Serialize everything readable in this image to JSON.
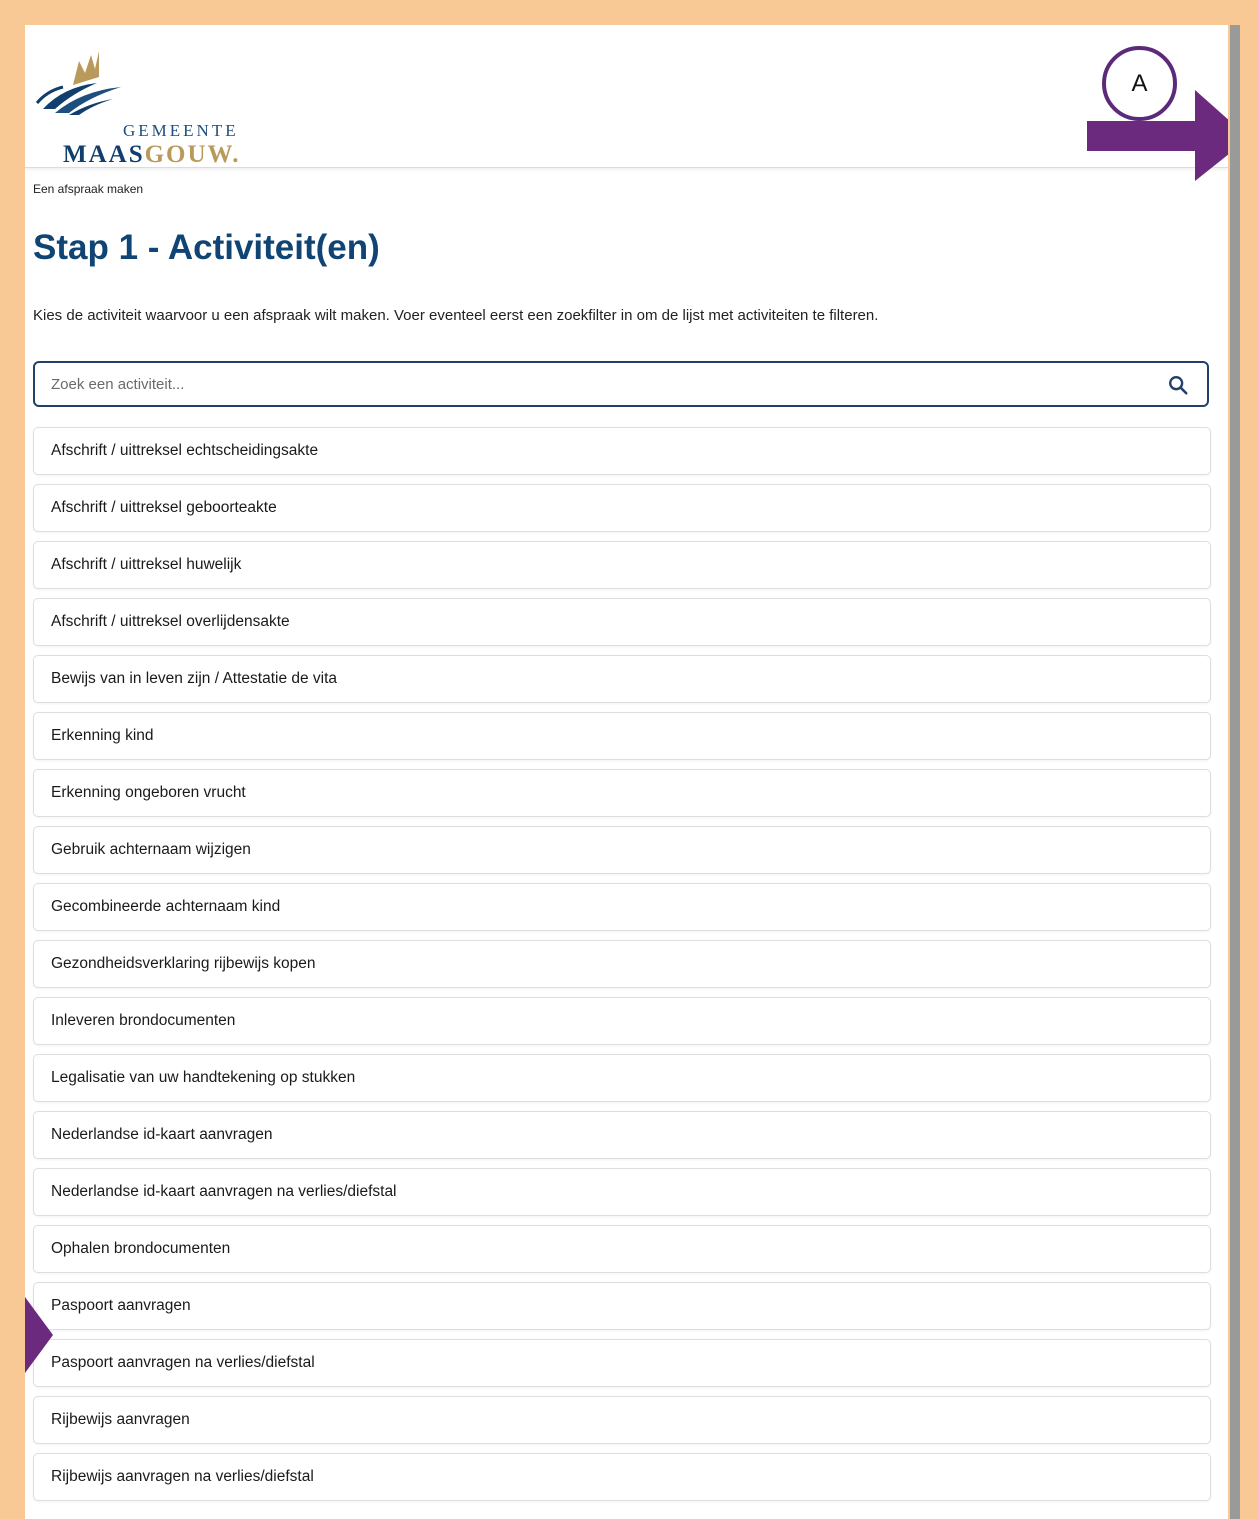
{
  "brand": {
    "line1": "GEMEENTE",
    "name_part1": "MAAS",
    "name_part2": "GOUW."
  },
  "breadcrumb": "Een afspraak maken",
  "title": "Stap 1 - Activiteit(en)",
  "intro": "Kies de activiteit waarvoor u een afspraak wilt maken. Voer eventeel eerst een zoekfilter in om de lijst met activiteiten te filteren.",
  "search": {
    "placeholder": "Zoek een activiteit...",
    "icon": "search-icon"
  },
  "activities": [
    "Afschrift / uittreksel echtscheidingsakte",
    "Afschrift / uittreksel geboorteakte",
    "Afschrift / uittreksel huwelijk",
    "Afschrift / uittreksel overlijdensakte",
    "Bewijs van in leven zijn / Attestatie de vita",
    "Erkenning kind",
    "Erkenning ongeboren vrucht",
    "Gebruik achternaam wijzigen",
    "Gecombineerde achternaam kind",
    "Gezondheidsverklaring rijbewijs kopen",
    "Inleveren brondocumenten",
    "Legalisatie van uw handtekening op stukken",
    "Nederlandse id-kaart aanvragen",
    "Nederlandse id-kaart aanvragen na verlies/diefstal",
    "Ophalen brondocumenten",
    "Paspoort aanvragen",
    "Paspoort aanvragen na verlies/diefstal",
    "Rijbewijs aanvragen",
    "Rijbewijs aanvragen na verlies/diefstal"
  ],
  "annotation": {
    "label": "A"
  },
  "colors": {
    "frame": "#f8c994",
    "title": "#0f4474",
    "annotation_arrow": "#6b2a7e",
    "search_border": "#23406a",
    "logo_gold": "#b99a5b",
    "logo_blue": "#103f6e"
  }
}
